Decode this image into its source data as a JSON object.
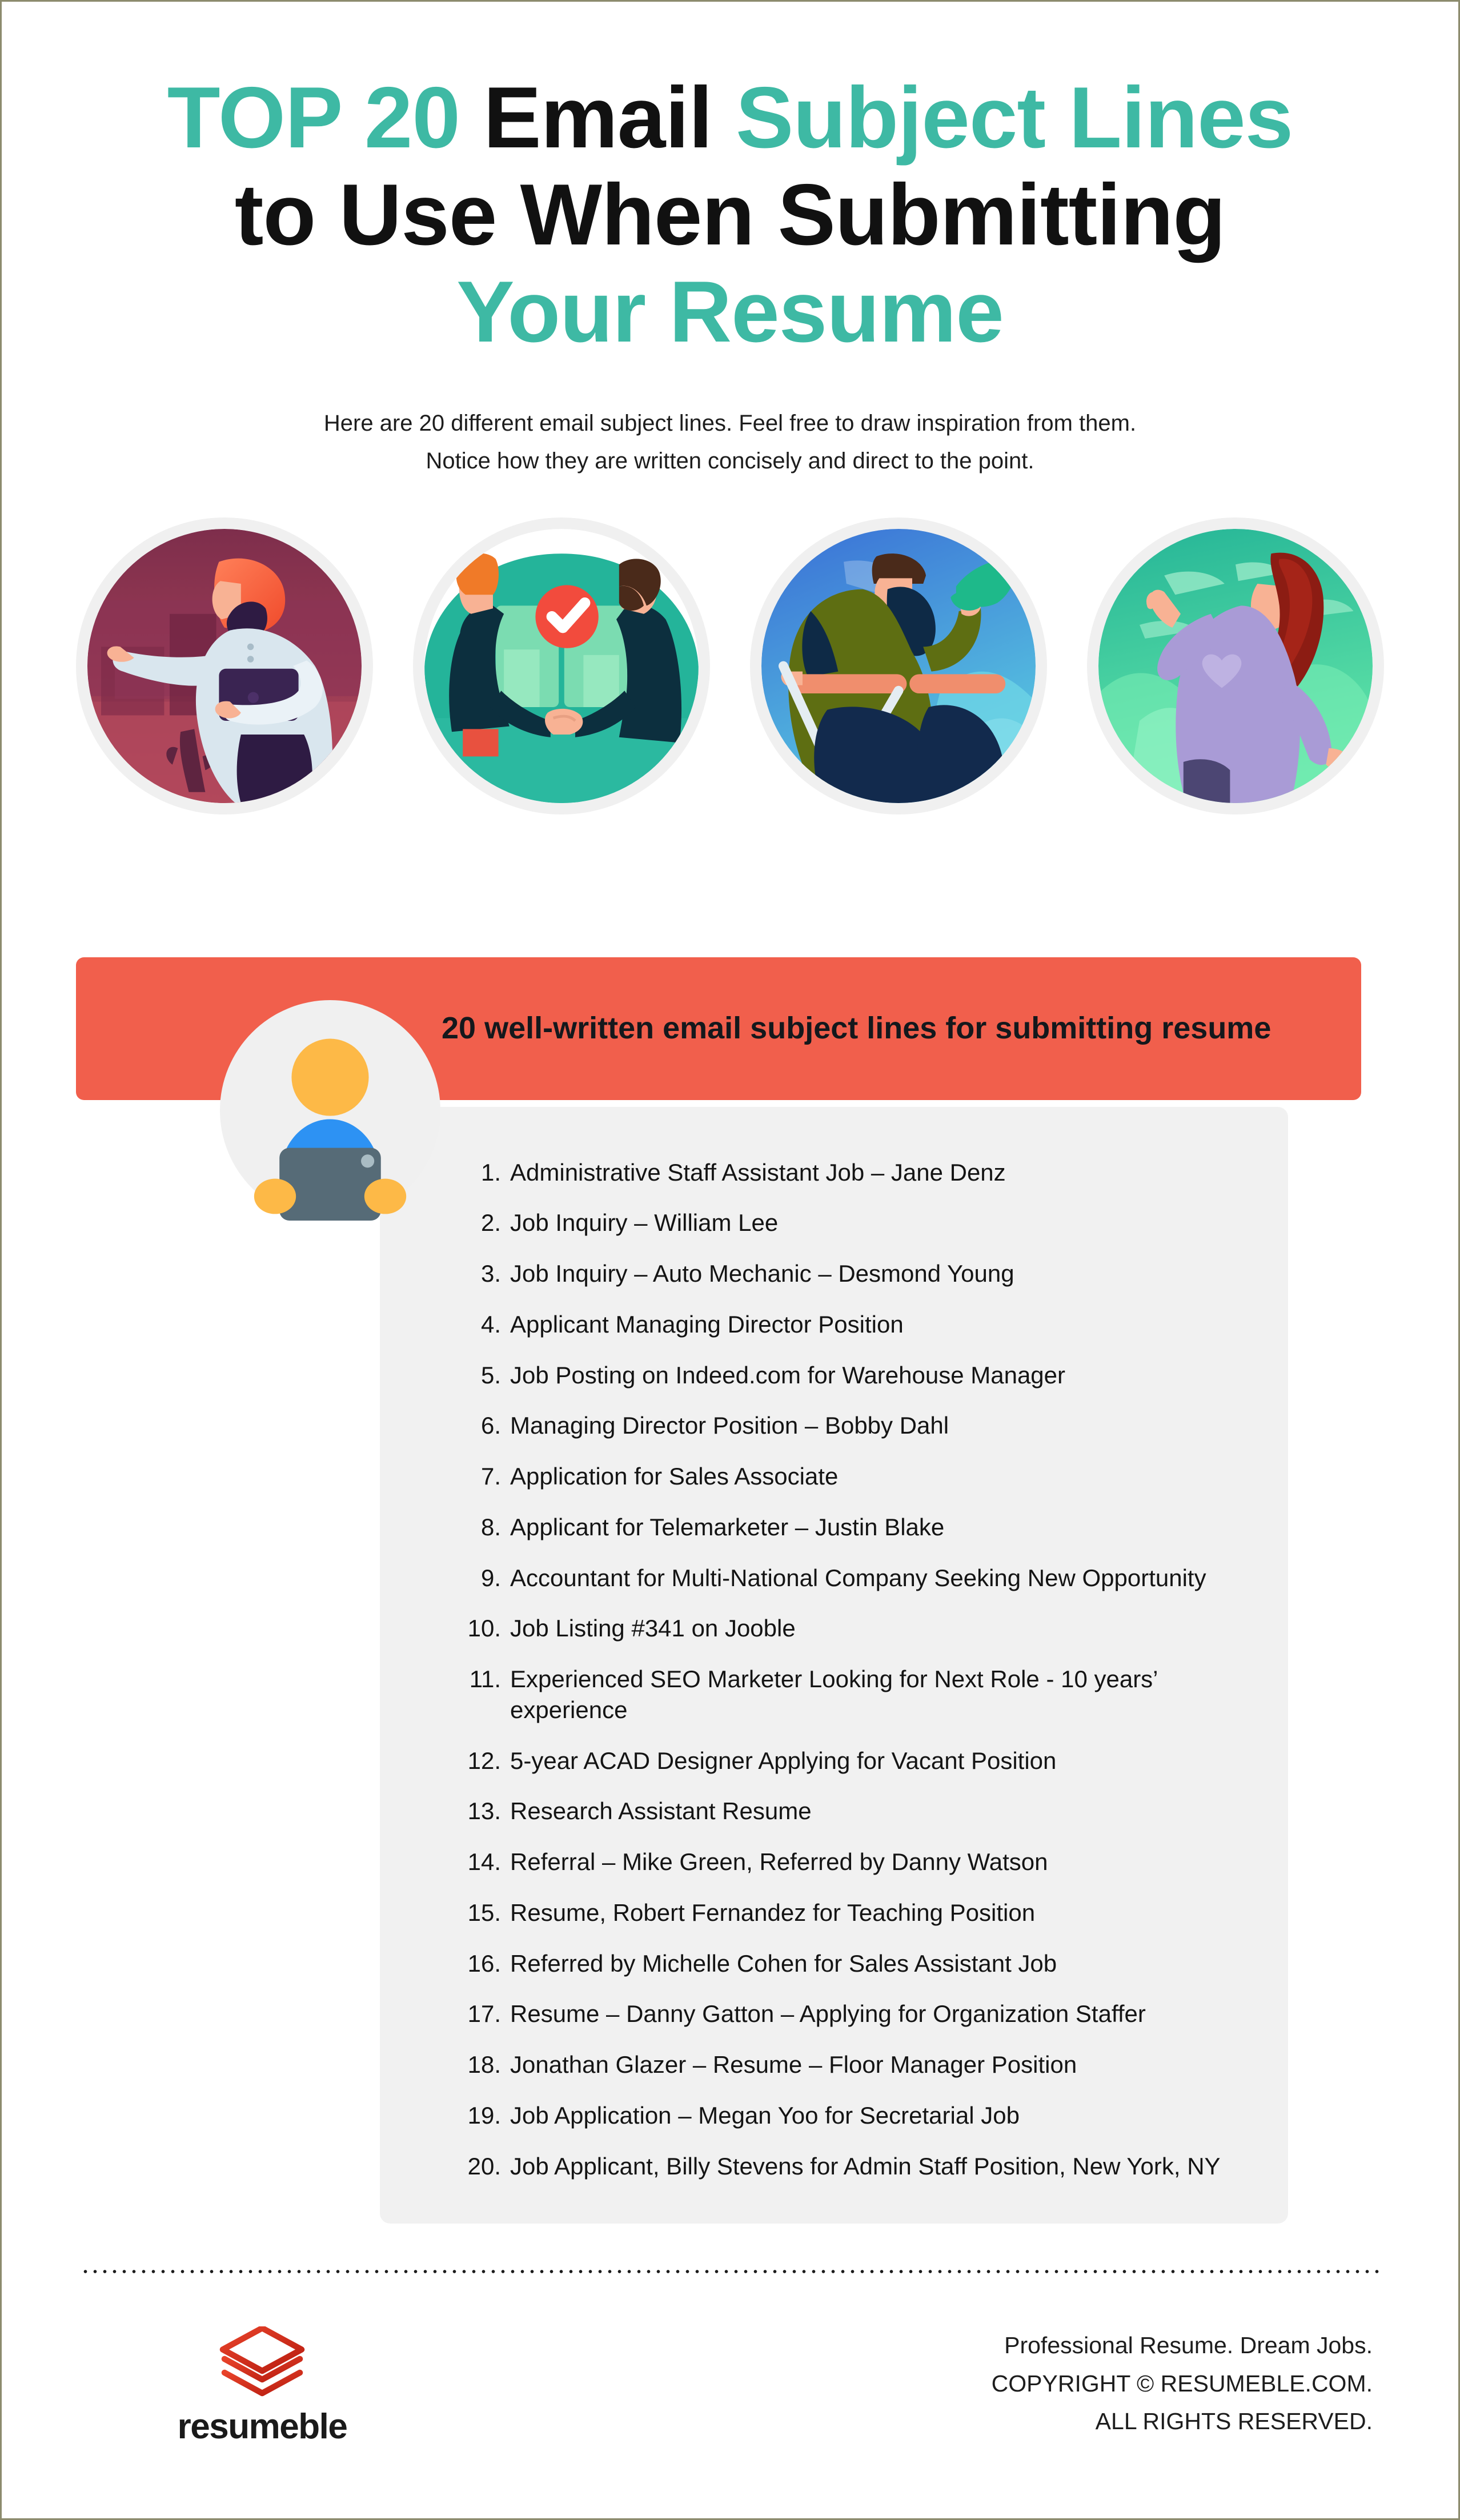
{
  "title": {
    "line1_part1": "TOP 20",
    "line1_part2": "Email",
    "line1_part3": "Subject Lines",
    "line2": "to Use When Submitting",
    "line3": "Your Resume"
  },
  "subtitle": "Here are 20 different email subject lines. Feel free to draw inspiration from them. Notice how they are written concisely and direct to the point.",
  "illustrations": [
    {
      "name": "woman-with-laptop",
      "bg": "#8E3A55"
    },
    {
      "name": "handshake-approved",
      "bg": "#24B49A"
    },
    {
      "name": "man-with-megaphone",
      "bg": "#3B77D8"
    },
    {
      "name": "woman-celebrating",
      "bg": "#3FC99B"
    }
  ],
  "banner": {
    "heading": "20 well-written email subject lines for submitting resume",
    "color": "#F15F4C",
    "avatar_icon": "person-with-laptop-avatar"
  },
  "list": {
    "items": [
      "Administrative Staff Assistant Job – Jane Denz",
      "Job Inquiry – William Lee",
      "Job Inquiry – Auto Mechanic – Desmond Young",
      "Applicant Managing Director Position",
      "Job Posting on Indeed.com for Warehouse Manager",
      "Managing Director Position – Bobby Dahl",
      "Application for Sales Associate",
      "Applicant for Telemarketer – Justin Blake",
      "Accountant for Multi-National Company Seeking New Opportunity",
      "Job Listing #341 on Jooble",
      "Experienced SEO Marketer Looking for Next Role - 10 years’ experience",
      "5-year ACAD Designer Applying for Vacant Position",
      "Research Assistant Resume",
      "Referral – Mike Green, Referred by Danny Watson",
      "Resume, Robert Fernandez for Teaching Position",
      "Referred by Michelle Cohen for Sales Assistant Job",
      "Resume – Danny Gatton – Applying for Organization Staffer",
      "Jonathan Glazer – Resume – Floor Manager Position",
      "Job Application – Megan Yoo for Secretarial Job",
      "Job Applicant, Billy Stevens for Admin Staff Position, New York, NY"
    ]
  },
  "footer": {
    "brand_name": "resumeble",
    "brand_mark": "stacked-layers-logo",
    "tagline": "Professional Resume. Dream Jobs.",
    "copyright": "COPYRIGHT © RESUMEBLE.COM.",
    "rights": "ALL RIGHTS RESERVED."
  },
  "colors": {
    "teal": "#3EB9A4",
    "orange": "#F15F4C",
    "logo_red": "#CC2418",
    "card_gray": "#F1F1F1"
  }
}
